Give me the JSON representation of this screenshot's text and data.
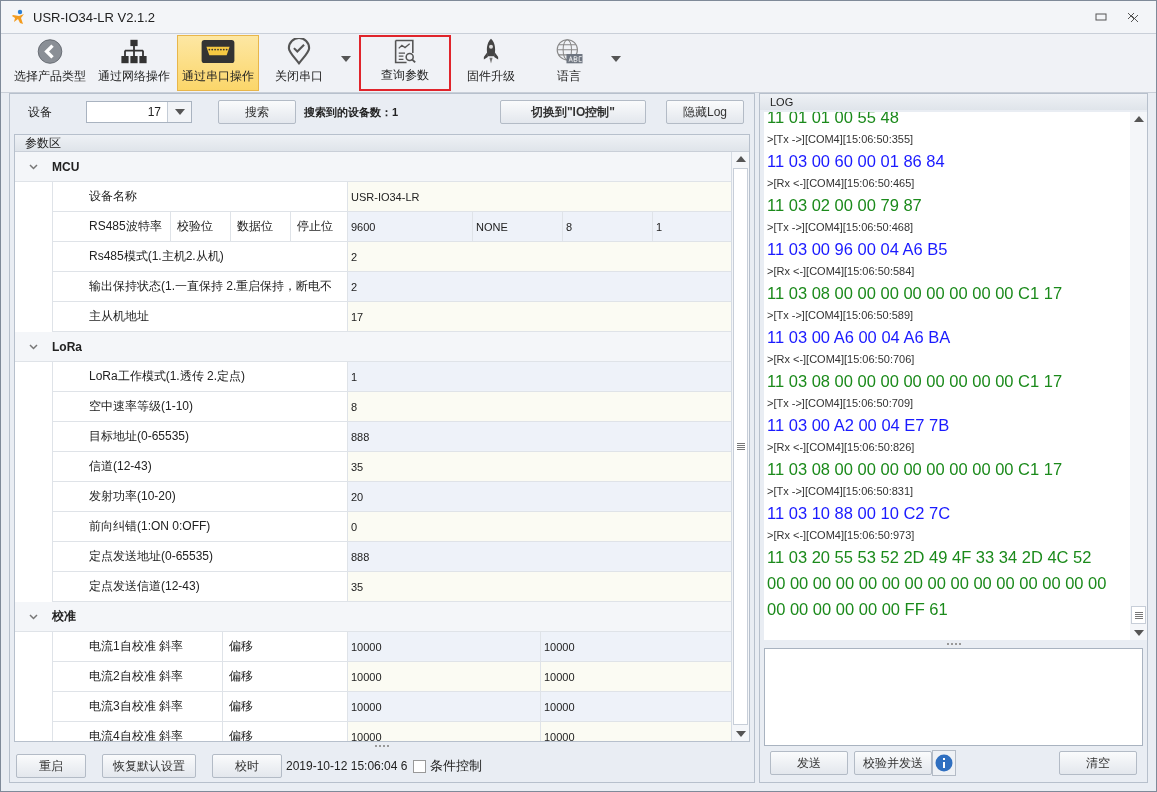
{
  "window": {
    "title": "USR-IO34-LR V2.1.2"
  },
  "toolbar": [
    {
      "label": "选择产品类型",
      "kind": "back",
      "selected": false,
      "dropdown": false,
      "highlighted": false
    },
    {
      "label": "通过网络操作",
      "kind": "network",
      "selected": false,
      "dropdown": false,
      "highlighted": false
    },
    {
      "label": "通过串口操作",
      "kind": "serial",
      "selected": true,
      "dropdown": false,
      "highlighted": false
    },
    {
      "label": "关闭串口",
      "kind": "pin",
      "selected": false,
      "dropdown": true,
      "highlighted": false
    },
    {
      "label": "查询参数",
      "kind": "query",
      "selected": false,
      "dropdown": false,
      "highlighted": true
    },
    {
      "label": "固件升级",
      "kind": "rocket",
      "selected": false,
      "dropdown": false,
      "highlighted": false
    },
    {
      "label": "语言",
      "kind": "globe",
      "selected": false,
      "dropdown": true,
      "highlighted": false
    }
  ],
  "device_bar": {
    "label": "设备",
    "device": "17",
    "search_button": "搜索",
    "found": "搜索到的设备数：1",
    "switch_button": "切换到\"IO控制\"",
    "hide_log_button": "隐藏Log"
  },
  "params": {
    "title": "参数区",
    "groups": [
      {
        "name": "MCU",
        "expanded": true,
        "rows": [
          {
            "labels": [
              "设备名称"
            ],
            "values": [
              "USR-IO34-LR"
            ]
          },
          {
            "labels": [
              "RS485波特率",
              "校验位",
              "数据位",
              "停止位"
            ],
            "values": [
              "9600",
              "NONE",
              "8",
              "1"
            ]
          },
          {
            "labels": [
              "Rs485模式(1.主机2.从机)"
            ],
            "values": [
              "2"
            ]
          },
          {
            "labels": [
              "输出保持状态(1.一直保持 2.重启保持，断电不"
            ],
            "values": [
              "2"
            ]
          },
          {
            "labels": [
              "主从机地址"
            ],
            "values": [
              "17"
            ]
          }
        ]
      },
      {
        "name": "LoRa",
        "expanded": true,
        "rows": [
          {
            "labels": [
              "LoRa工作模式(1.透传 2.定点)"
            ],
            "values": [
              "1"
            ]
          },
          {
            "labels": [
              "空中速率等级(1-10)"
            ],
            "values": [
              "8"
            ]
          },
          {
            "labels": [
              "目标地址(0-65535)"
            ],
            "values": [
              "888"
            ]
          },
          {
            "labels": [
              "信道(12-43)"
            ],
            "values": [
              "35"
            ]
          },
          {
            "labels": [
              "发射功率(10-20)"
            ],
            "values": [
              "20"
            ]
          },
          {
            "labels": [
              "前向纠错(1:ON 0:OFF)"
            ],
            "values": [
              "0"
            ]
          },
          {
            "labels": [
              "定点发送地址(0-65535)"
            ],
            "values": [
              "888"
            ]
          },
          {
            "labels": [
              "定点发送信道(12-43)"
            ],
            "values": [
              "35"
            ]
          }
        ]
      },
      {
        "name": "校准",
        "expanded": true,
        "rows": [
          {
            "labels": [
              "电流1自校准  斜率",
              "偏移"
            ],
            "values": [
              "10000",
              "10000"
            ]
          },
          {
            "labels": [
              "电流2自校准  斜率",
              "偏移"
            ],
            "values": [
              "10000",
              "10000"
            ]
          },
          {
            "labels": [
              "电流3自校准  斜率",
              "偏移"
            ],
            "values": [
              "10000",
              "10000"
            ]
          },
          {
            "labels": [
              "电流4自校准  斜率",
              "偏移"
            ],
            "values": [
              "10000",
              "10000"
            ]
          }
        ]
      }
    ]
  },
  "bottom_bar": {
    "buttons": [
      "重启",
      "恢复默认设置",
      "校时"
    ],
    "timestamp": "2019-10-12 15:06:04 6",
    "checkbox": {
      "label": "条件控制",
      "checked": false
    }
  },
  "log": {
    "title": "LOG",
    "entries": [
      {
        "kind": "rx",
        "text": "11 01 01 00 55 48"
      },
      {
        "kind": "meta",
        "text": ">[Tx ->][COM4][15:06:50:355]"
      },
      {
        "kind": "tx",
        "text": "11 03 00 60 00 01 86 84"
      },
      {
        "kind": "meta",
        "text": ">[Rx <-][COM4][15:06:50:465]"
      },
      {
        "kind": "rx",
        "text": "11 03 02 00 00 79 87"
      },
      {
        "kind": "meta",
        "text": ">[Tx ->][COM4][15:06:50:468]"
      },
      {
        "kind": "tx",
        "text": "11 03 00 96 00 04 A6 B5"
      },
      {
        "kind": "meta",
        "text": ">[Rx <-][COM4][15:06:50:584]"
      },
      {
        "kind": "rx",
        "text": "11 03 08 00 00 00 00 00 00 00 00 C1 17"
      },
      {
        "kind": "meta",
        "text": ">[Tx ->][COM4][15:06:50:589]"
      },
      {
        "kind": "tx",
        "text": "11 03 00 A6 00 04 A6 BA"
      },
      {
        "kind": "meta",
        "text": ">[Rx <-][COM4][15:06:50:706]"
      },
      {
        "kind": "rx",
        "text": "11 03 08 00 00 00 00 00 00 00 00 C1 17"
      },
      {
        "kind": "meta",
        "text": ">[Tx ->][COM4][15:06:50:709]"
      },
      {
        "kind": "tx",
        "text": "11 03 00 A2 00 04 E7 7B"
      },
      {
        "kind": "meta",
        "text": ">[Rx <-][COM4][15:06:50:826]"
      },
      {
        "kind": "rx",
        "text": "11 03 08 00 00 00 00 00 00 00 00 C1 17"
      },
      {
        "kind": "meta",
        "text": ">[Tx ->][COM4][15:06:50:831]"
      },
      {
        "kind": "tx",
        "text": "11 03 10 88 00 10 C2 7C"
      },
      {
        "kind": "meta",
        "text": ">[Rx <-][COM4][15:06:50:973]"
      },
      {
        "kind": "rx",
        "text": "11 03 20 55 53 52 2D 49 4F 33 34 2D 4C 52"
      },
      {
        "kind": "rx",
        "text": "00 00 00 00 00 00 00 00 00 00 00 00 00 00 00"
      },
      {
        "kind": "rx",
        "text": "00 00 00 00 00 00 FF 61"
      }
    ],
    "buttons": [
      "发送",
      "校验并发送",
      "清空"
    ]
  }
}
